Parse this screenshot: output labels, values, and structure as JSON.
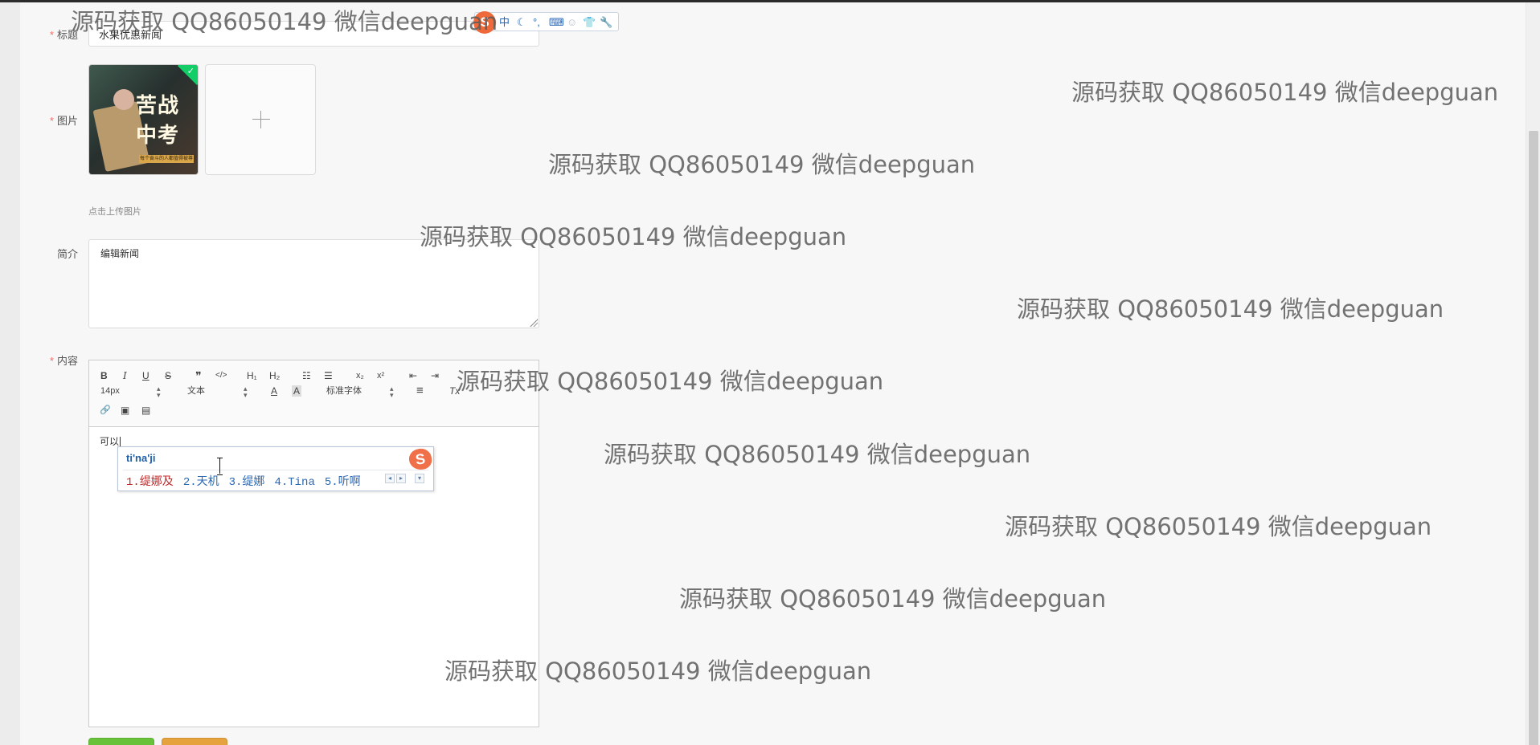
{
  "form": {
    "title_label": "标题",
    "title_value": "水果优惠新闻",
    "image_label": "图片",
    "image_hint": "点击上传图片",
    "image_thumb_title": "苦战中考",
    "image_thumb_sub": "每个奋斗的人都值得被尊重",
    "summary_label": "简介",
    "summary_value": "编辑新闻",
    "content_label": "内容",
    "required_mark": "*"
  },
  "editor": {
    "toolbar": {
      "bold": "B",
      "italic": "I",
      "underline": "U",
      "strike": "S",
      "blockquote": "❞",
      "code": "</>",
      "h1": "H₁",
      "h2": "H₂",
      "ordered_list": "☷",
      "bullet_list": "☰",
      "subscript": "x₂",
      "superscript": "x²",
      "outdent": "⇤",
      "indent": "⇥",
      "size_value": "14px",
      "header_value": "文本",
      "font_value": "标准字体",
      "font_color": "A",
      "background_color": "A",
      "align": "≡",
      "clean": "Tx",
      "link": "🔗",
      "image": "▣",
      "video": "▤"
    },
    "body_text": "可以"
  },
  "ime": {
    "input": "ti'na'ji",
    "candidates": [
      "1.缇娜及",
      "2.天机",
      "3.缇娜",
      "4.Tina",
      "5.听啊"
    ],
    "logo": "S",
    "status_items": [
      "中",
      "☾",
      "°,",
      "⌨",
      "☺",
      "👕",
      "🔧"
    ]
  },
  "watermark_text": "源码获取 QQ86050149 微信deepguan",
  "colors": {
    "required": "#f56c6c",
    "success": "#13ce66",
    "ime_blue": "#2a67b1",
    "ime_red": "#c02a2a",
    "button_green": "#67c23a",
    "button_orange": "#e6a23c"
  }
}
